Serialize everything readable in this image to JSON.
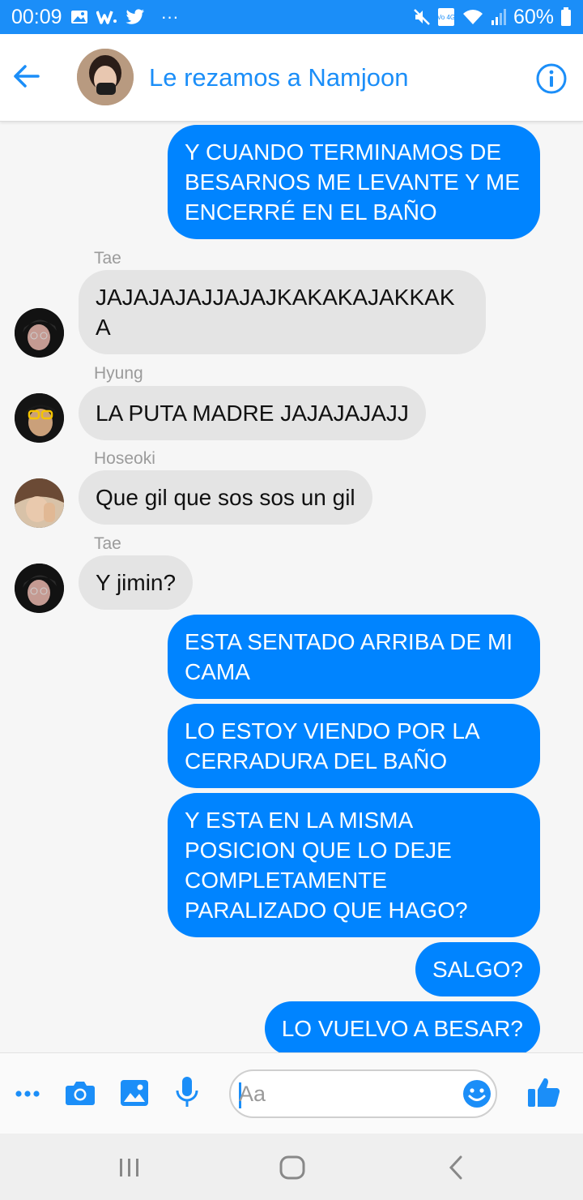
{
  "status_bar": {
    "time": "00:09",
    "more": "···",
    "battery": "60%",
    "net_label": "Vo 4G",
    "left_icons": [
      "image-icon",
      "w-app-icon",
      "twitter-icon"
    ],
    "right_icons": [
      "mute-icon",
      "volte-4g-icon",
      "wifi-icon",
      "signal-icon",
      "battery-icon"
    ]
  },
  "header": {
    "title": "Le rezamos a Namjoon",
    "back_icon": "back-arrow-icon",
    "info_icon": "info-icon"
  },
  "messages": [
    {
      "id": "m1",
      "direction": "outgoing",
      "text": "Y CUANDO TERMINAMOS DE BESARNOS ME LEVANTE Y ME ENCERRÉ EN EL BAÑO"
    },
    {
      "id": "m2",
      "direction": "incoming",
      "sender": "Tae",
      "text": "JAJAJAJAJJAJAJKAKAKAJAKKAKA"
    },
    {
      "id": "m3",
      "direction": "incoming",
      "sender": "Hyung",
      "text": "LA PUTA MADRE JAJAJAJAJJ"
    },
    {
      "id": "m4",
      "direction": "incoming",
      "sender": "Hoseoki",
      "text": "Que gil que sos sos un gil"
    },
    {
      "id": "m5",
      "direction": "incoming",
      "sender": "Tae",
      "text": "Y jimin?"
    },
    {
      "id": "m6",
      "direction": "outgoing",
      "text": "ESTA SENTADO ARRIBA DE MI CAMA"
    },
    {
      "id": "m7",
      "direction": "outgoing",
      "text": "LO ESTOY VIENDO POR LA CERRADURA DEL BAÑO"
    },
    {
      "id": "m8",
      "direction": "outgoing",
      "text": "Y ESTA EN LA MISMA POSICION QUE LO DEJE COMPLETAMENTE PARALIZADO QUE HAGO?"
    },
    {
      "id": "m9",
      "direction": "outgoing",
      "text": "SALGO?"
    },
    {
      "id": "m10",
      "direction": "outgoing",
      "text": "LO VUELVO A BESAR?"
    }
  ],
  "composer": {
    "placeholder": "Aa",
    "icons": [
      "more-icon",
      "camera-icon",
      "gallery-icon",
      "microphone-icon",
      "emoji-icon",
      "thumbs-up-icon"
    ]
  },
  "nav_bar": {
    "icons": [
      "recent-apps-icon",
      "home-icon",
      "back-icon"
    ]
  },
  "colors": {
    "accent": "#1b8ef8",
    "outgoing_bubble": "#0084ff",
    "incoming_bubble": "#e4e4e4",
    "background": "#f6f6f6"
  }
}
